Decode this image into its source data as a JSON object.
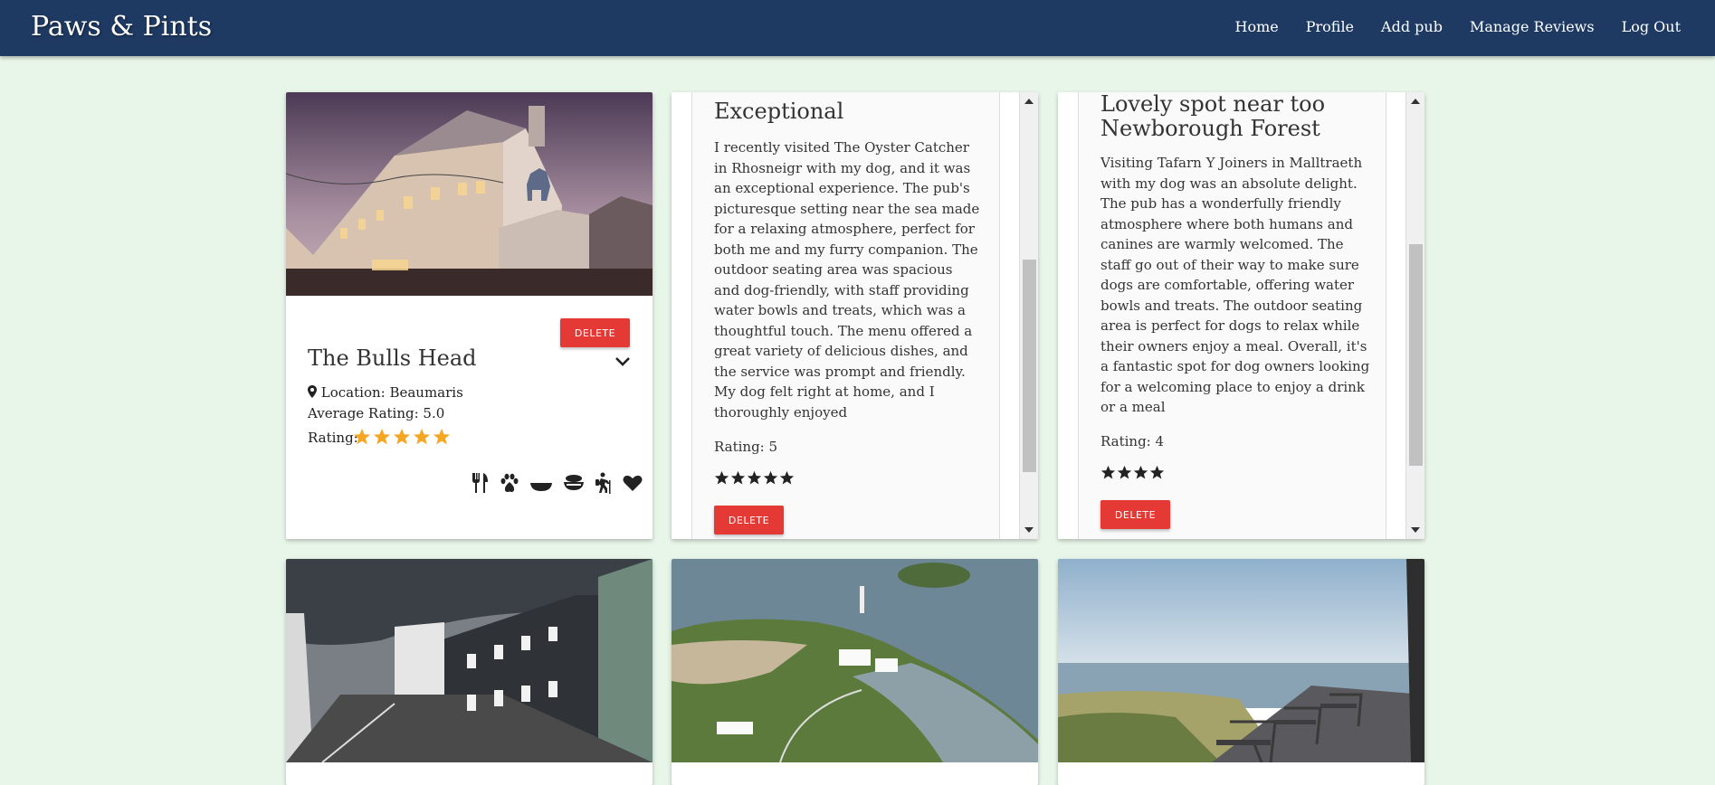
{
  "brand": "Paws & Pints",
  "nav": {
    "items": [
      "Home",
      "Profile",
      "Add pub",
      "Manage Reviews",
      "Log Out"
    ]
  },
  "pub_card": {
    "delete_label": "DELETE",
    "name": "The Bulls Head",
    "location": "Location: Beaumaris",
    "average_rating": "Average Rating: 5.0",
    "rating_label": "Rating:",
    "rating_stars": 5,
    "star_color": "#f5a623",
    "amenity_icons": [
      "cutlery-icon",
      "paw-icon",
      "bowl-icon",
      "dog-treat-icon",
      "hiking-icon",
      "heart-icon"
    ]
  },
  "reviews": [
    {
      "title": "Exceptional",
      "body": "I recently visited The Oyster Catcher in Rhosneigr with my dog, and it was an exceptional experience. The pub's picturesque setting near the sea made for a relaxing atmosphere, perfect for both me and my furry companion. The outdoor seating area was spacious and dog-friendly, with staff providing water bowls and treats, which was a thoughtful touch. The menu offered a great variety of delicious dishes, and the service was prompt and friendly. My dog felt right at home, and I thoroughly enjoyed",
      "rating": "Rating: 5",
      "stars": 5,
      "delete_label": "DELETE"
    },
    {
      "title": "Lovely spot near too Newborough Forest",
      "body": "Visiting Tafarn Y Joiners in Malltraeth with my dog was an absolute delight. The pub has a wonderfully friendly atmosphere where both humans and canines are warmly welcomed. The staff go out of their way to make sure dogs are comfortable, offering water bowls and treats. The outdoor seating area is perfect for dogs to relax while their owners enjoy a meal. Overall, it's a fantastic spot for dog owners looking for a welcoming place to enjoy a drink or a meal",
      "rating": "Rating: 4",
      "stars": 4,
      "delete_label": "DELETE"
    }
  ],
  "colors": {
    "navbar": "#1e3a63",
    "background": "#e8f5e9",
    "delete": "#e53935"
  }
}
